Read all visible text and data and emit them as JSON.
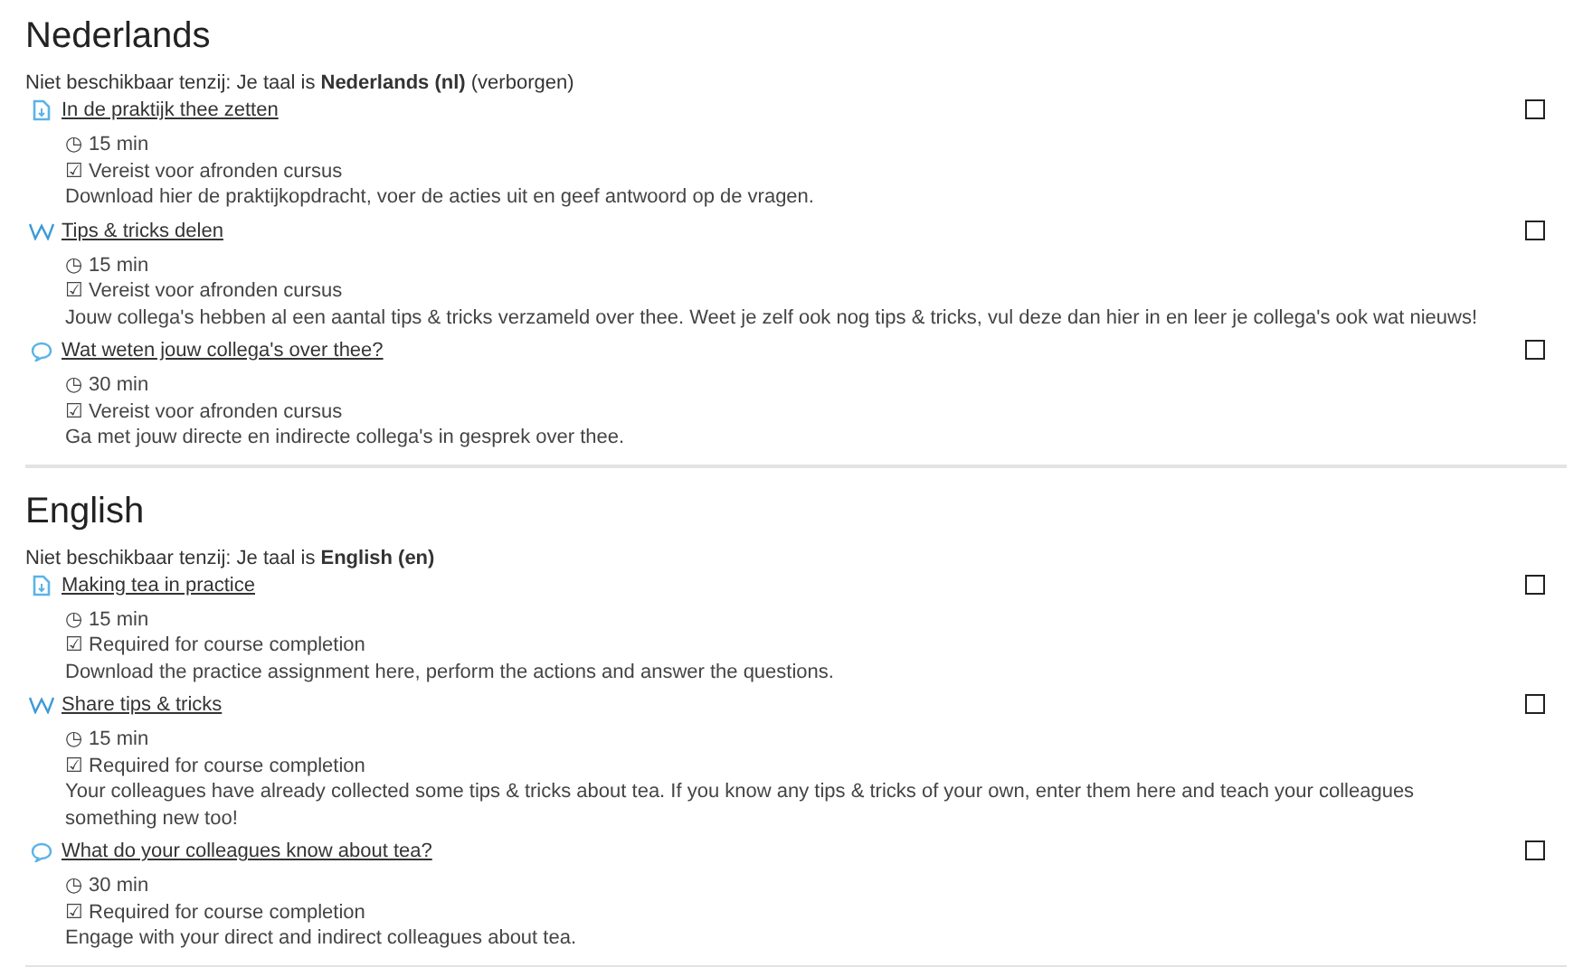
{
  "sections": [
    {
      "title": "Nederlands",
      "restriction": "Niet beschikbaar tenzij: Je taal is **Nederlands (nl)** (verborgen)",
      "activities": [
        {
          "kind": "assignment",
          "name": "In de praktijk thee zetten",
          "duration": "◷ 15 min",
          "requirement": "☑ Vereist voor afronden cursus",
          "description": "Download hier de praktijkopdracht, voer de acties uit en geef antwoord op de vragen.",
          "checked": false
        },
        {
          "kind": "wiki",
          "name": "Tips & tricks delen",
          "duration": "◷ 15 min",
          "requirement": "☑ Vereist voor afronden cursus",
          "description": "Jouw collega's hebben al een aantal tips & tricks verzameld over thee. Weet je zelf ook nog tips & tricks, vul deze dan hier in en leer je collega's ook wat nieuws!",
          "checked": false
        },
        {
          "kind": "forum",
          "name": "Wat weten jouw collega's over thee?",
          "duration": "◷ 30 min",
          "requirement": "☑ Vereist voor afronden cursus",
          "description": "Ga met jouw directe en indirecte collega's in gesprek over thee.",
          "checked": false
        }
      ]
    },
    {
      "title": "English",
      "restriction": "Niet beschikbaar tenzij: Je taal is **English (en)**",
      "activities": [
        {
          "kind": "assignment",
          "name": "Making tea in practice",
          "duration": "◷ 15 min",
          "requirement": "☑ Required for course completion",
          "description": "Download the practice assignment here, perform the actions and answer the questions.",
          "checked": false
        },
        {
          "kind": "wiki",
          "name": "Share tips & tricks",
          "duration": "◷ 15 min",
          "requirement": "☑ Required for course completion",
          "description": "Your colleagues have already collected some tips & tricks about tea. If you know any tips & tricks of your own, enter them here and teach your colleagues something new too!",
          "checked": false
        },
        {
          "kind": "forum",
          "name": "What do your colleagues know about tea?",
          "duration": "◷ 30 min",
          "requirement": "☑ Required for course completion",
          "description": "Engage with your direct and indirect colleagues about tea.",
          "checked": false
        }
      ]
    }
  ]
}
